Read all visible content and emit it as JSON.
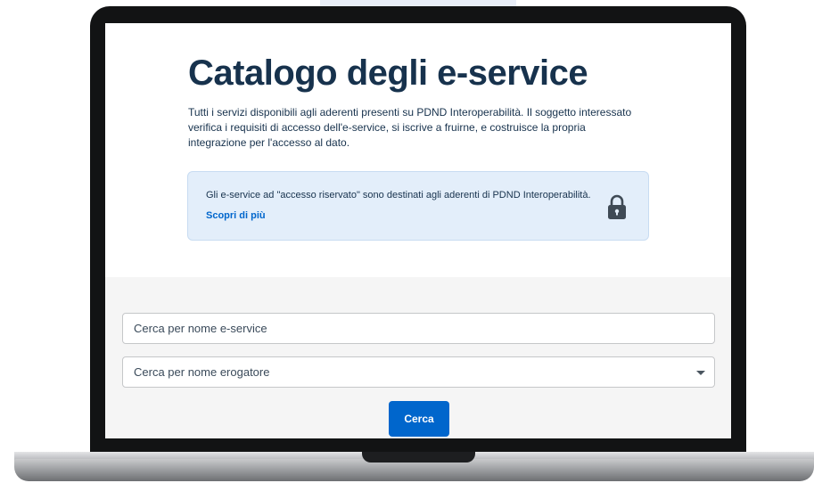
{
  "page": {
    "title": "Catalogo degli e-service",
    "intro": "Tutti i servizi disponibili agli aderenti presenti su PDND Interoperabilità. Il soggetto interessato verifica i requisiti di accesso dell'e-service, si iscrive a fruirne, e costruisce la propria integrazione per l'accesso al dato."
  },
  "notice": {
    "text": "Gli e-service ad \"accesso riservato\" sono destinati agli aderenti di PDND Interoperabilità.",
    "link": "Scopri di più",
    "icon": "lock-icon"
  },
  "search": {
    "name_placeholder": "Cerca per nome e-service",
    "provider_placeholder": "Cerca per nome erogatore",
    "button_label": "Cerca"
  },
  "colors": {
    "title": "#17324d",
    "accent": "#0066cc",
    "notice_bg": "#e3eefa",
    "search_bg": "#f5f5f5"
  }
}
